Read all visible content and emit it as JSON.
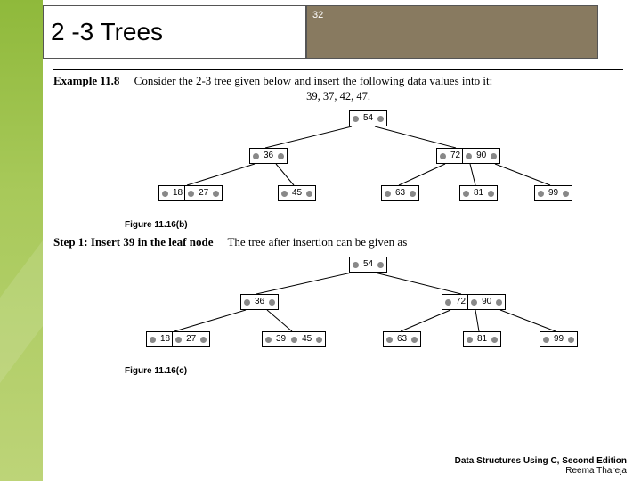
{
  "title": "2 -3 Trees",
  "page_number": "32",
  "example_label": "Example 11.8",
  "example_text": "Consider the 2-3 tree given below and insert the following data values into it:",
  "insert_values": "39, 37, 42, 47.",
  "step_label": "Step 1: Insert 39 in the leaf node",
  "step_text": "The tree after insertion can be given as",
  "fig_b_caption": "Figure 11.16(b)",
  "fig_c_caption": "Figure 11.16(c)",
  "footer_book": "Data Structures Using C, Second Edition",
  "footer_author": "Reema Thareja",
  "tree_b": {
    "root": [
      "54"
    ],
    "mid": [
      [
        "36"
      ],
      [
        "72",
        "90"
      ]
    ],
    "leaves": [
      [
        "18",
        "27"
      ],
      [
        "45"
      ],
      [
        "63"
      ],
      [
        "81"
      ],
      [
        "99"
      ]
    ]
  },
  "tree_c": {
    "root": [
      "54"
    ],
    "mid": [
      [
        "36"
      ],
      [
        "72",
        "90"
      ]
    ],
    "leaves": [
      [
        "18",
        "27"
      ],
      [
        "39",
        "45"
      ],
      [
        "63"
      ],
      [
        "81"
      ],
      [
        "99"
      ]
    ]
  }
}
